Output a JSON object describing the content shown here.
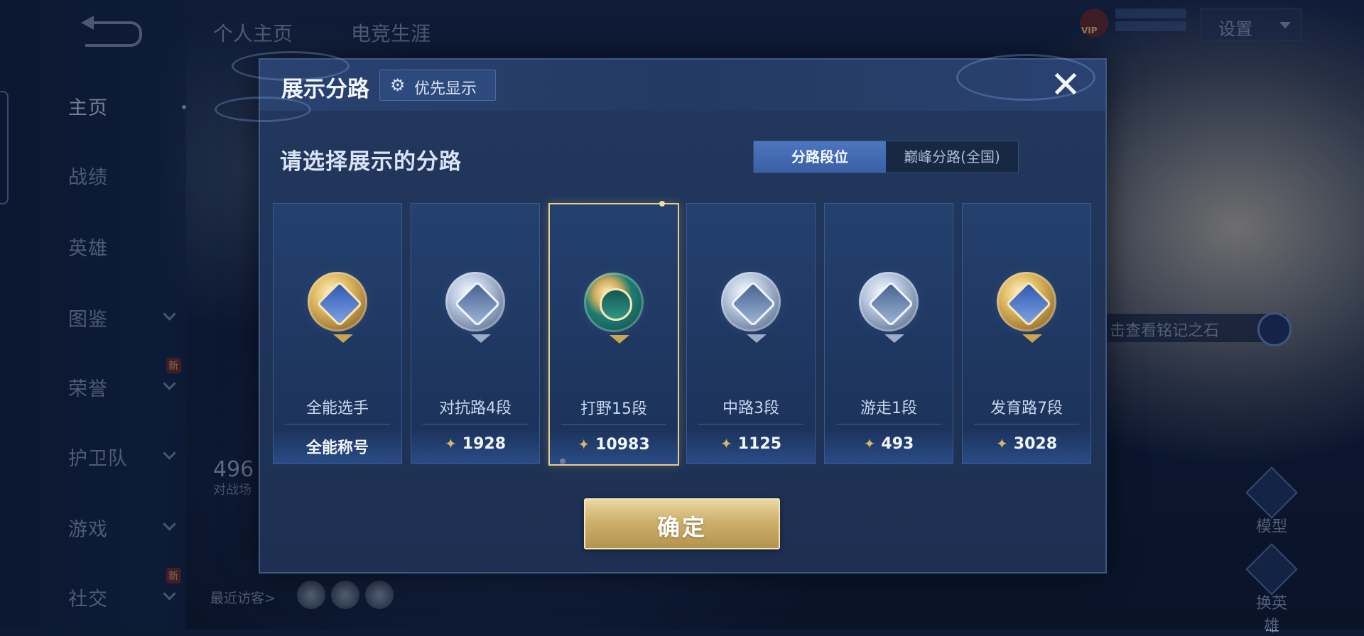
{
  "sidebar": {
    "items": [
      {
        "label": "主页",
        "active": true,
        "has_chevron": false,
        "new": false
      },
      {
        "label": "战绩",
        "active": false,
        "has_chevron": false,
        "new": false
      },
      {
        "label": "英雄",
        "active": false,
        "has_chevron": false,
        "new": false
      },
      {
        "label": "图鉴",
        "active": false,
        "has_chevron": true,
        "new": false
      },
      {
        "label": "荣誉",
        "active": false,
        "has_chevron": true,
        "new": true
      },
      {
        "label": "护卫队",
        "active": false,
        "has_chevron": true,
        "new": false
      },
      {
        "label": "游戏",
        "active": false,
        "has_chevron": true,
        "new": false
      },
      {
        "label": "社交",
        "active": false,
        "has_chevron": true,
        "new": true
      }
    ],
    "new_badge": "新"
  },
  "top_tabs": [
    "个人主页",
    "电竞生涯"
  ],
  "header_right": {
    "settings_label": "设置",
    "vip_label": "VIP"
  },
  "profile": {
    "stat_number": "496",
    "stat_label": "对战场",
    "recent_visitors_label": "最近访客>"
  },
  "right_panel": {
    "rune_tip": "击查看铭记之石",
    "model_label": "模型",
    "switch_hero_label": "换英雄"
  },
  "modal": {
    "title": "展示分路",
    "priority_button": "优先显示",
    "subtitle": "请选择展示的分路",
    "segments": [
      {
        "label": "分路段位",
        "selected": true
      },
      {
        "label": "巅峰分路(全国)",
        "selected": false
      }
    ],
    "cards": [
      {
        "lane": "全能选手",
        "score": "全能称号",
        "show_points_icon": false,
        "badge": "gold",
        "selected": false
      },
      {
        "lane": "对抗路4段",
        "score": "1928",
        "show_points_icon": true,
        "badge": "silver",
        "selected": false
      },
      {
        "lane": "打野15段",
        "score": "10983",
        "show_points_icon": true,
        "badge": "jade",
        "selected": true
      },
      {
        "lane": "中路3段",
        "score": "1125",
        "show_points_icon": true,
        "badge": "silver",
        "selected": false
      },
      {
        "lane": "游走1段",
        "score": "493",
        "show_points_icon": true,
        "badge": "silver",
        "selected": false
      },
      {
        "lane": "发育路7段",
        "score": "3028",
        "show_points_icon": true,
        "badge": "gold",
        "selected": false
      }
    ],
    "confirm_button": "确定"
  },
  "colors": {
    "accent_gold": "#e7cf8b",
    "segment_active": "#4d76c0",
    "modal_bg": "#22365b"
  }
}
